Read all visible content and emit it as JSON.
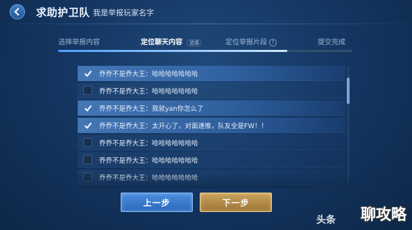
{
  "header": {
    "title": "求助护卫队",
    "subtitle": "我是举报玩家名字"
  },
  "steps": [
    {
      "label": "选择举报内容",
      "state": "done"
    },
    {
      "label": "定位聊天内容",
      "state": "active",
      "note": "选填"
    },
    {
      "label": "定位举报片段",
      "state": "pending",
      "help": "?"
    },
    {
      "label": "提交完成",
      "state": "pending"
    }
  ],
  "messages": [
    {
      "text": "乔乔不是乔大王：哈哈哈哈哈哈哈",
      "checked": true
    },
    {
      "text": "乔乔不是乔大王：哈哈哈哈哈哈哈",
      "checked": false
    },
    {
      "text": "乔乔不是乔大王：我就yan你怎么了",
      "checked": true
    },
    {
      "text": "乔乔不是乔大王：太开心了，对面速推，队友全是FW！！",
      "checked": true
    },
    {
      "text": "乔乔不是乔大王：哈哈哈哈哈哈哈",
      "checked": false
    },
    {
      "text": "乔乔不是乔大王：哈哈哈哈哈哈哈",
      "checked": false
    },
    {
      "text": "乔乔不是乔大王：哈哈哈哈哈哈哈",
      "checked": false
    }
  ],
  "buttons": {
    "prev": "上一步",
    "next": "下一步"
  },
  "watermark": {
    "left": "头条",
    "right": "聊攻略"
  },
  "colors": {
    "accent_blue": "#4b8fe0",
    "accent_gold": "#caa35b",
    "background": "#153763"
  }
}
